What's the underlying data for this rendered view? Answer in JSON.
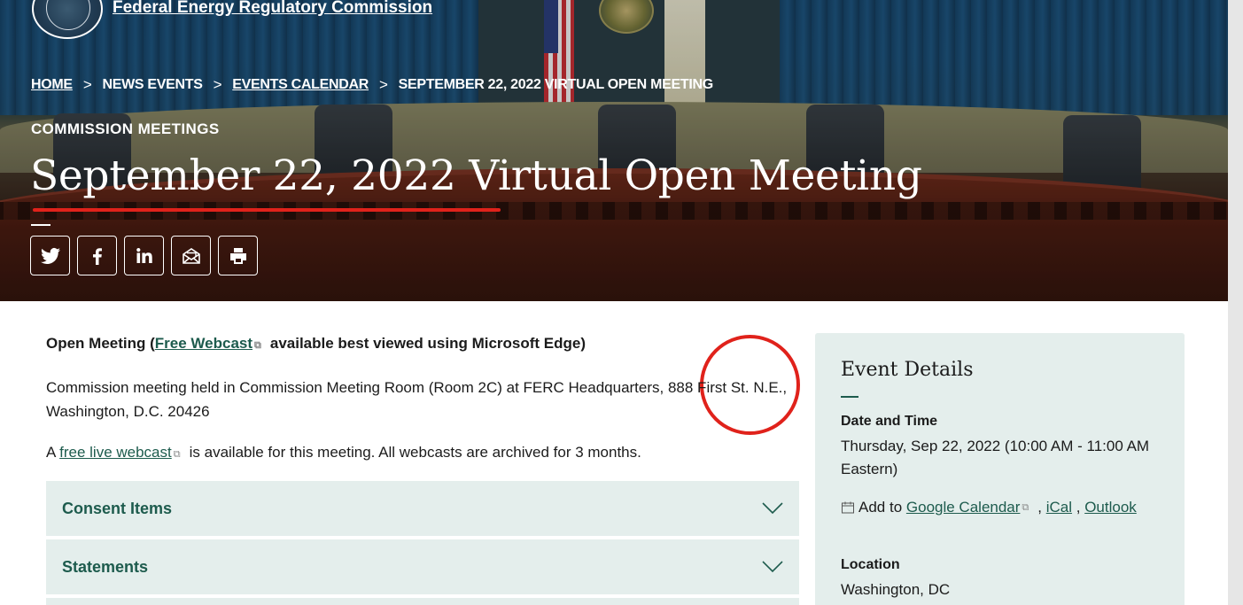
{
  "header": {
    "agency_name": "Federal Energy Regulatory Commission"
  },
  "breadcrumb": {
    "items": [
      {
        "label": "HOME",
        "link": true
      },
      {
        "label": "NEWS EVENTS",
        "link": false
      },
      {
        "label": "EVENTS CALENDAR",
        "link": true
      },
      {
        "label": "SEPTEMBER 22, 2022 VIRTUAL OPEN MEETING",
        "link": false
      }
    ],
    "separator": ">"
  },
  "hero": {
    "eyebrow": "COMMISSION MEETINGS",
    "title": "September 22, 2022 Virtual Open Meeting"
  },
  "share": {
    "buttons": [
      "twitter-icon",
      "facebook-icon",
      "linkedin-icon",
      "email-icon",
      "print-icon"
    ]
  },
  "main": {
    "lead_prefix": "Open Meeting (",
    "lead_link": "Free Webcast",
    "lead_suffix": "available best viewed using Microsoft Edge)",
    "location_paragraph": "Commission meeting held in Commission Meeting Room (Room 2C) at FERC Headquarters, 888 First St. N.E., Washington, D.C. 20426",
    "webcast_prefix": "A ",
    "webcast_link": "free live webcast",
    "webcast_suffix": "is available for this meeting. All webcasts are archived for 3 months.",
    "accordions": [
      {
        "label": "Consent Items"
      },
      {
        "label": "Statements"
      }
    ]
  },
  "sidebar": {
    "title": "Event Details",
    "date_label": "Date and Time",
    "date_value": "Thursday, Sep 22, 2022 (10:00 AM - 11:00 AM Eastern)",
    "add_to": "Add to",
    "google_link": "Google Calendar",
    "ical_link": "iCal",
    "outlook_link": "Outlook",
    "location_label": "Location",
    "location_value": "Washington, DC"
  },
  "colors": {
    "accent_green": "#1d5b4d",
    "panel_bg": "#e4eeec",
    "annotation_red": "#e0221b"
  }
}
